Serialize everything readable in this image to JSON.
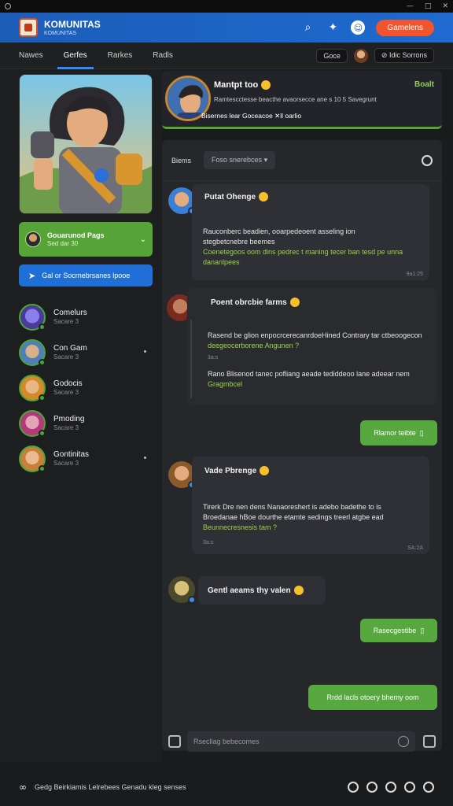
{
  "app": {
    "name": "KOMUNITAS",
    "tagline": "KOMUNITAS"
  },
  "header": {
    "cta_label": "Gamelens"
  },
  "nav": {
    "tabs": [
      {
        "label": "Nawes",
        "active": false
      },
      {
        "label": "Gerfes",
        "active": true
      },
      {
        "label": "Rarkes",
        "active": false
      },
      {
        "label": "Radls",
        "active": false
      }
    ],
    "status_pill": "Goce",
    "user_pill": "Idic Sorrons"
  },
  "sidebar": {
    "promo": {
      "title": "Gouarunod Pags",
      "subtitle": "Sed dar 30"
    },
    "jump_label": "Gal or Socrnebrsanes lpooe",
    "friends": [
      {
        "name": "Comelurs",
        "status": "Sacare 3",
        "color": "#6a5ad0"
      },
      {
        "name": "Con Gam",
        "status": "Sacare 3",
        "color": "#4f7fb8"
      },
      {
        "name": "Godocis",
        "status": "Sacare 3",
        "color": "#d48a2a"
      },
      {
        "name": "Pmoding",
        "status": "Sacare 3",
        "color": "#b23a7a"
      },
      {
        "name": "Gontinitas",
        "status": "Sacare 3",
        "color": "#c6803c"
      }
    ]
  },
  "profile": {
    "name": "Mantpt too",
    "bio": "Ramtescctesse beacthe avaorsecce ane s 10 5 Savegrunt",
    "stats": "Bisernes lear Goceacoe ✕ll oarlio",
    "action": "Boalt"
  },
  "chat": {
    "header_label": "Biems",
    "filter_placeholder": "Foso snerebces",
    "messages": [
      {
        "sender": "Putat Ohenge",
        "lines": [
          {
            "t": "Rauconberc beadien, ooarpedeoent asseling ion",
            "hl": false
          },
          {
            "t": "stegbetcnebre beemes",
            "hl": false
          },
          {
            "t": "Coenetegoos oom dins pedrec t maning tecer ban tesd pe unna",
            "hl": true
          },
          {
            "t": "dananlpees",
            "hl": true
          }
        ],
        "time": "9a1:25"
      },
      {
        "sender": "Poent obrcbie farms",
        "lines": [
          {
            "t": "Rasend be glion enpocrcerecanrdoeHined Contrary tar ctbeoogecon",
            "hl": false
          },
          {
            "t": "deegeocerborene Angunen ?",
            "hl": true
          },
          {
            "t": "3a:s",
            "hl": false
          },
          {
            "t": "Rano Blisenod tanec pofliang aeade tediddeoo lane adeear nem",
            "hl": false
          },
          {
            "t": "Gragmbcel",
            "hl": true
          }
        ],
        "reply": "Rlamor teibte"
      },
      {
        "sender": "Vade Pbrenge",
        "lines": [
          {
            "t": "Tirerk Dre nen dens Nanaoreshert is adebo badethe to is",
            "hl": false
          },
          {
            "t": "Broedanae hBoe dourthe etamte sedings treerl atgbe ead",
            "hl": false
          },
          {
            "t": "Beunnecresnesis tam ?",
            "hl": true
          },
          {
            "t": "3a:s",
            "hl": false
          }
        ],
        "time": "SA:2A"
      },
      {
        "sender": "Gentl aeams thy valen"
      }
    ],
    "outgoing": [
      {
        "text": "Rasecgestibe"
      },
      {
        "text": "Rrdd lacls otoery bhemy oom"
      }
    ],
    "input_placeholder": "Rsecliag bebecomes"
  },
  "footer": {
    "text": "Gedg Beirkiamis Lelrebees Genadu kleg senses"
  }
}
